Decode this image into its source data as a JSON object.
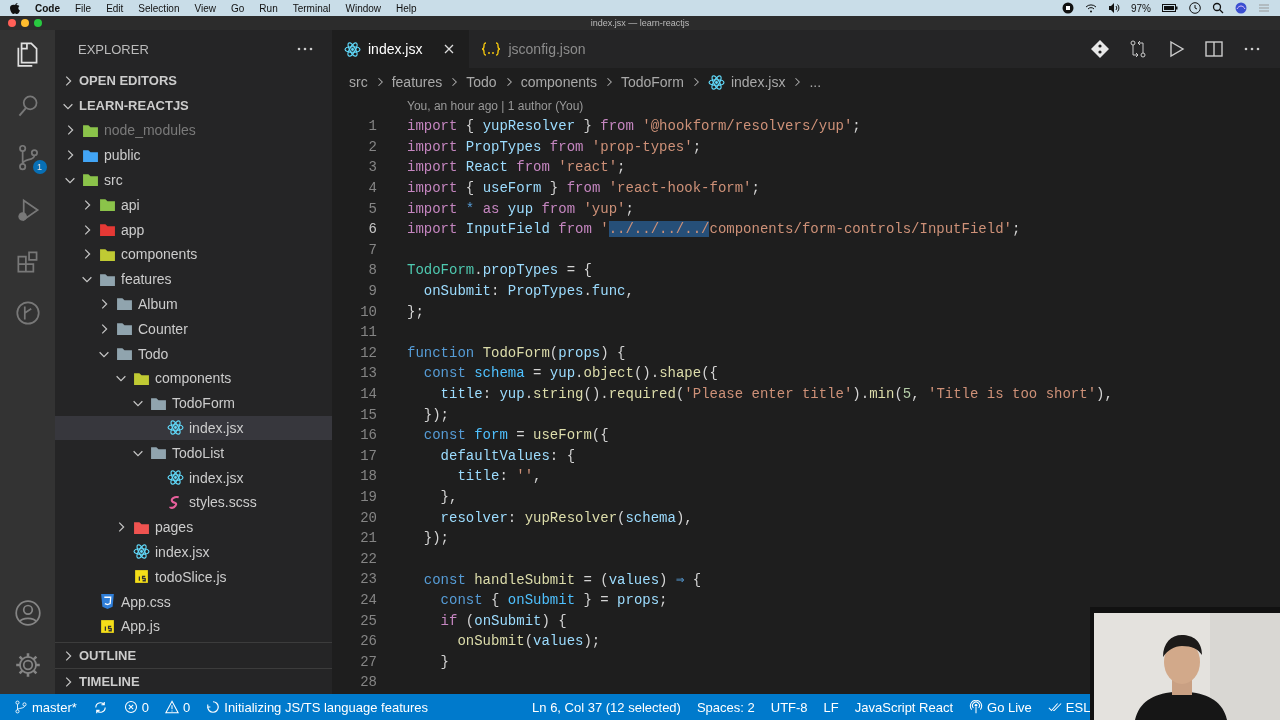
{
  "menu_bar": {
    "app": "Code",
    "items": [
      "File",
      "Edit",
      "Selection",
      "View",
      "Go",
      "Run",
      "Terminal",
      "Window",
      "Help"
    ],
    "battery": "97%"
  },
  "window": {
    "title": "index.jsx — learn-reactjs"
  },
  "activity_bar": {
    "items": [
      {
        "kind": "files",
        "selected": true
      },
      {
        "kind": "search",
        "selected": false
      },
      {
        "kind": "source-control",
        "selected": false,
        "badge": "1"
      },
      {
        "kind": "debug",
        "selected": false
      },
      {
        "kind": "extensions",
        "selected": false
      },
      {
        "kind": "git-graph",
        "selected": false
      }
    ],
    "bottom": [
      {
        "kind": "account"
      },
      {
        "kind": "settings"
      }
    ]
  },
  "sidebar": {
    "title": "EXPLORER",
    "sections": [
      {
        "label": "OPEN EDITORS",
        "expanded": false
      },
      {
        "label": "LEARN-REACTJS",
        "expanded": true
      }
    ],
    "tree": [
      {
        "label": "node_modules",
        "kind": "folder",
        "color": "#8bc34a",
        "expanded": false,
        "selected": false,
        "ignored": true
      },
      {
        "label": "public",
        "kind": "folder",
        "color": "#42a5f5",
        "expanded": false,
        "selected": false,
        "ignored": false
      },
      {
        "label": "src",
        "kind": "folder",
        "color": "#8bc34a",
        "expanded": true,
        "selected": false,
        "ignored": false,
        "children": [
          {
            "label": "api",
            "kind": "folder",
            "color": "#8bc34a",
            "expanded": false,
            "selected": false,
            "ignored": false
          },
          {
            "label": "app",
            "kind": "folder",
            "color": "#e53935",
            "expanded": false,
            "selected": false,
            "ignored": false
          },
          {
            "label": "components",
            "kind": "folder",
            "color": "#c0ca33",
            "expanded": false,
            "selected": false,
            "ignored": false
          },
          {
            "label": "features",
            "kind": "folder",
            "color": "#90a4ae",
            "expanded": true,
            "selected": false,
            "ignored": false,
            "children": [
              {
                "label": "Album",
                "kind": "folder",
                "color": "#90a4ae",
                "expanded": false,
                "selected": false,
                "ignored": false
              },
              {
                "label": "Counter",
                "kind": "folder",
                "color": "#90a4ae",
                "expanded": false,
                "selected": false,
                "ignored": false
              },
              {
                "label": "Todo",
                "kind": "folder",
                "color": "#90a4ae",
                "expanded": true,
                "selected": false,
                "ignored": false,
                "children": [
                  {
                    "label": "components",
                    "kind": "folder",
                    "color": "#c0ca33",
                    "expanded": true,
                    "selected": false,
                    "ignored": false,
                    "children": [
                      {
                        "label": "TodoForm",
                        "kind": "folder",
                        "color": "#90a4ae",
                        "expanded": true,
                        "selected": false,
                        "ignored": false,
                        "children": [
                          {
                            "label": "index.jsx",
                            "kind": "react",
                            "selected": true,
                            "ignored": false
                          }
                        ]
                      },
                      {
                        "label": "TodoList",
                        "kind": "folder",
                        "color": "#90a4ae",
                        "expanded": true,
                        "selected": false,
                        "ignored": false,
                        "children": [
                          {
                            "label": "index.jsx",
                            "kind": "react",
                            "selected": false,
                            "ignored": false
                          },
                          {
                            "label": "styles.scss",
                            "kind": "scss",
                            "selected": false,
                            "ignored": false
                          }
                        ]
                      }
                    ]
                  },
                  {
                    "label": "pages",
                    "kind": "folder",
                    "color": "#ef5350",
                    "expanded": false,
                    "selected": false,
                    "ignored": false
                  },
                  {
                    "label": "index.jsx",
                    "kind": "react",
                    "selected": false,
                    "ignored": false
                  },
                  {
                    "label": "todoSlice.js",
                    "kind": "js",
                    "selected": false,
                    "ignored": false
                  }
                ]
              }
            ]
          },
          {
            "label": "App.css",
            "kind": "css",
            "selected": false,
            "ignored": false
          },
          {
            "label": "App.js",
            "kind": "js",
            "selected": false,
            "ignored": false
          }
        ]
      }
    ],
    "bottom_sections": [
      {
        "label": "OUTLINE",
        "expanded": false
      },
      {
        "label": "TIMELINE",
        "expanded": false
      }
    ]
  },
  "tabs": [
    {
      "label": "index.jsx",
      "kind": "react",
      "selected": true
    },
    {
      "label": "jsconfig.json",
      "kind": "json",
      "selected": false
    }
  ],
  "breadcrumbs": [
    {
      "label": "src",
      "kind": "folder"
    },
    {
      "label": "features",
      "kind": "folder"
    },
    {
      "label": "Todo",
      "kind": "folder"
    },
    {
      "label": "components",
      "kind": "folder"
    },
    {
      "label": "TodoForm",
      "kind": "folder"
    },
    {
      "label": "index.jsx",
      "kind": "react"
    },
    {
      "label": "...",
      "kind": "symbol"
    }
  ],
  "codelens": "You, an hour ago | 1 author (You)",
  "code": [
    {
      "number": "1",
      "tokens": [
        {
          "kind": "kw",
          "text": "import"
        },
        {
          "kind": "punct",
          "text": " { "
        },
        {
          "kind": "var",
          "text": "yupResolver"
        },
        {
          "kind": "punct",
          "text": " } "
        },
        {
          "kind": "kw",
          "text": "from "
        },
        {
          "kind": "str",
          "text": "'@hookform/resolvers/yup'"
        },
        {
          "kind": "punct",
          "text": ";"
        }
      ]
    },
    {
      "number": "2",
      "tokens": [
        {
          "kind": "kw",
          "text": "import "
        },
        {
          "kind": "var",
          "text": "PropTypes "
        },
        {
          "kind": "kw",
          "text": "from "
        },
        {
          "kind": "str",
          "text": "'prop-types'"
        },
        {
          "kind": "punct",
          "text": ";"
        }
      ]
    },
    {
      "number": "3",
      "tokens": [
        {
          "kind": "kw",
          "text": "import "
        },
        {
          "kind": "var",
          "text": "React "
        },
        {
          "kind": "kw",
          "text": "from "
        },
        {
          "kind": "str",
          "text": "'react'"
        },
        {
          "kind": "punct",
          "text": ";"
        }
      ]
    },
    {
      "number": "4",
      "tokens": [
        {
          "kind": "kw",
          "text": "import"
        },
        {
          "kind": "punct",
          "text": " { "
        },
        {
          "kind": "var",
          "text": "useForm"
        },
        {
          "kind": "punct",
          "text": " } "
        },
        {
          "kind": "kw",
          "text": "from "
        },
        {
          "kind": "str",
          "text": "'react-hook-form'"
        },
        {
          "kind": "punct",
          "text": ";"
        }
      ]
    },
    {
      "number": "5",
      "tokens": [
        {
          "kind": "kw",
          "text": "import "
        },
        {
          "kind": "storage",
          "text": "* "
        },
        {
          "kind": "kw",
          "text": "as "
        },
        {
          "kind": "var",
          "text": "yup "
        },
        {
          "kind": "kw",
          "text": "from "
        },
        {
          "kind": "str",
          "text": "'yup'"
        },
        {
          "kind": "punct",
          "text": ";"
        }
      ]
    },
    {
      "number": "6",
      "tokens": [
        {
          "kind": "kw",
          "text": "import "
        },
        {
          "kind": "var",
          "text": "InputField "
        },
        {
          "kind": "kw",
          "text": "from "
        },
        {
          "kind": "str",
          "text": "'"
        },
        {
          "kind": "selection",
          "text": "../../../../"
        },
        {
          "kind": "str",
          "text": "components/form-controls/InputField'"
        },
        {
          "kind": "punct",
          "text": ";"
        }
      ]
    },
    {
      "number": "7"
    },
    {
      "number": "8",
      "tokens": [
        {
          "kind": "type",
          "text": "TodoForm"
        },
        {
          "kind": "punct",
          "text": "."
        },
        {
          "kind": "var",
          "text": "propTypes"
        },
        {
          "kind": "punct",
          "text": " = {"
        }
      ]
    },
    {
      "number": "9",
      "tokens": [
        {
          "kind": "var",
          "text": "  onSubmit"
        },
        {
          "kind": "punct",
          "text": ": "
        },
        {
          "kind": "var",
          "text": "PropTypes"
        },
        {
          "kind": "punct",
          "text": "."
        },
        {
          "kind": "var",
          "text": "func"
        },
        {
          "kind": "punct",
          "text": ","
        }
      ]
    },
    {
      "number": "10",
      "tokens": [
        {
          "kind": "punct",
          "text": "};"
        }
      ]
    },
    {
      "number": "11"
    },
    {
      "number": "12",
      "tokens": [
        {
          "kind": "storage",
          "text": "function "
        },
        {
          "kind": "fn",
          "text": "TodoForm"
        },
        {
          "kind": "punct",
          "text": "("
        },
        {
          "kind": "var",
          "text": "props"
        },
        {
          "kind": "punct",
          "text": ") {"
        }
      ]
    },
    {
      "number": "13",
      "tokens": [
        {
          "kind": "storage",
          "text": "  const "
        },
        {
          "kind": "const",
          "text": "schema"
        },
        {
          "kind": "punct",
          "text": " = "
        },
        {
          "kind": "var",
          "text": "yup"
        },
        {
          "kind": "punct",
          "text": "."
        },
        {
          "kind": "fn",
          "text": "object"
        },
        {
          "kind": "punct",
          "text": "()."
        },
        {
          "kind": "fn",
          "text": "shape"
        },
        {
          "kind": "punct",
          "text": "({"
        }
      ]
    },
    {
      "number": "14",
      "tokens": [
        {
          "kind": "var",
          "text": "    title"
        },
        {
          "kind": "punct",
          "text": ": "
        },
        {
          "kind": "var",
          "text": "yup"
        },
        {
          "kind": "punct",
          "text": "."
        },
        {
          "kind": "fn",
          "text": "string"
        },
        {
          "kind": "punct",
          "text": "()."
        },
        {
          "kind": "fn",
          "text": "required"
        },
        {
          "kind": "punct",
          "text": "("
        },
        {
          "kind": "str",
          "text": "'Please enter title'"
        },
        {
          "kind": "punct",
          "text": ")."
        },
        {
          "kind": "fn",
          "text": "min"
        },
        {
          "kind": "punct",
          "text": "("
        },
        {
          "kind": "num",
          "text": "5"
        },
        {
          "kind": "punct",
          "text": ", "
        },
        {
          "kind": "str",
          "text": "'Title is too short'"
        },
        {
          "kind": "punct",
          "text": "),"
        }
      ]
    },
    {
      "number": "15",
      "tokens": [
        {
          "kind": "punct",
          "text": "  });"
        }
      ]
    },
    {
      "number": "16",
      "tokens": [
        {
          "kind": "storage",
          "text": "  const "
        },
        {
          "kind": "const",
          "text": "form"
        },
        {
          "kind": "punct",
          "text": " = "
        },
        {
          "kind": "fn",
          "text": "useForm"
        },
        {
          "kind": "punct",
          "text": "({"
        }
      ]
    },
    {
      "number": "17",
      "tokens": [
        {
          "kind": "var",
          "text": "    defaultValues"
        },
        {
          "kind": "punct",
          "text": ": {"
        }
      ]
    },
    {
      "number": "18",
      "tokens": [
        {
          "kind": "var",
          "text": "      title"
        },
        {
          "kind": "punct",
          "text": ": "
        },
        {
          "kind": "str",
          "text": "''"
        },
        {
          "kind": "punct",
          "text": ","
        }
      ]
    },
    {
      "number": "19",
      "tokens": [
        {
          "kind": "punct",
          "text": "    },"
        }
      ]
    },
    {
      "number": "20",
      "tokens": [
        {
          "kind": "var",
          "text": "    resolver"
        },
        {
          "kind": "punct",
          "text": ": "
        },
        {
          "kind": "fn",
          "text": "yupResolver"
        },
        {
          "kind": "punct",
          "text": "("
        },
        {
          "kind": "var",
          "text": "schema"
        },
        {
          "kind": "punct",
          "text": "),"
        }
      ]
    },
    {
      "number": "21",
      "tokens": [
        {
          "kind": "punct",
          "text": "  });"
        }
      ]
    },
    {
      "number": "22"
    },
    {
      "number": "23",
      "tokens": [
        {
          "kind": "storage",
          "text": "  const "
        },
        {
          "kind": "fn",
          "text": "handleSubmit"
        },
        {
          "kind": "punct",
          "text": " = ("
        },
        {
          "kind": "var",
          "text": "values"
        },
        {
          "kind": "punct",
          "text": ") "
        },
        {
          "kind": "storage",
          "text": "⇒"
        },
        {
          "kind": "punct",
          "text": " {"
        }
      ]
    },
    {
      "number": "24",
      "tokens": [
        {
          "kind": "storage",
          "text": "    const"
        },
        {
          "kind": "punct",
          "text": " { "
        },
        {
          "kind": "const",
          "text": "onSubmit"
        },
        {
          "kind": "punct",
          "text": " } = "
        },
        {
          "kind": "var",
          "text": "props"
        },
        {
          "kind": "punct",
          "text": ";"
        }
      ]
    },
    {
      "number": "25",
      "tokens": [
        {
          "kind": "kw",
          "text": "    if"
        },
        {
          "kind": "punct",
          "text": " ("
        },
        {
          "kind": "var",
          "text": "onSubmit"
        },
        {
          "kind": "punct",
          "text": ") {"
        }
      ]
    },
    {
      "number": "26",
      "tokens": [
        {
          "kind": "fn",
          "text": "      onSubmit"
        },
        {
          "kind": "punct",
          "text": "("
        },
        {
          "kind": "var",
          "text": "values"
        },
        {
          "kind": "punct",
          "text": ");"
        }
      ]
    },
    {
      "number": "27",
      "tokens": [
        {
          "kind": "punct",
          "text": "    }"
        }
      ]
    },
    {
      "number": "28"
    }
  ],
  "status_bar": {
    "left": [
      {
        "kind": "branch",
        "text": "master*"
      },
      {
        "kind": "sync"
      },
      {
        "kind": "error",
        "text": "0"
      },
      {
        "kind": "warning",
        "text": "0"
      },
      {
        "kind": "spinner",
        "text": "Initializing JS/TS language features"
      }
    ],
    "right": [
      {
        "kind": "text",
        "text": "Ln 6, Col 37 (12 selected)"
      },
      {
        "kind": "text",
        "text": "Spaces: 2"
      },
      {
        "kind": "text",
        "text": "UTF-8"
      },
      {
        "kind": "text",
        "text": "LF"
      },
      {
        "kind": "text",
        "text": "JavaScript React"
      },
      {
        "kind": "broadcast",
        "text": "Go Live"
      },
      {
        "kind": "check",
        "text": "ESL"
      }
    ]
  }
}
